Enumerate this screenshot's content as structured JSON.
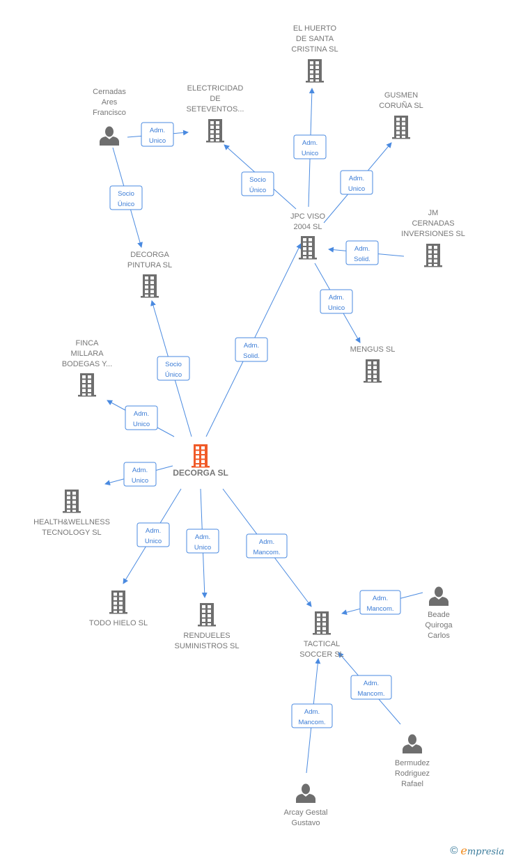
{
  "colors": {
    "main_node": "#f05a28",
    "node": "#6e6e6e",
    "edge": "#4a8ae0",
    "text": "#777777"
  },
  "nodes": [
    {
      "id": "decorga",
      "type": "company",
      "main": true,
      "label": [
        "DECORGA SL"
      ]
    },
    {
      "id": "cernadas",
      "type": "person",
      "label": [
        "Cernadas",
        "Ares",
        "Francisco"
      ]
    },
    {
      "id": "electricidad",
      "type": "company",
      "label": [
        "ELECTRICIDAD",
        "DE",
        "SETEVENTOS..."
      ]
    },
    {
      "id": "huerto",
      "type": "company",
      "label": [
        "EL HUERTO",
        "DE SANTA",
        "CRISTINA SL"
      ]
    },
    {
      "id": "gusmen",
      "type": "company",
      "label": [
        "GUSMEN",
        "CORUÑA SL"
      ]
    },
    {
      "id": "jpc",
      "type": "company",
      "label": [
        "JPC VISO",
        "2004 SL"
      ]
    },
    {
      "id": "jm",
      "type": "company",
      "label": [
        "JM",
        "CERNADAS",
        "INVERSIONES SL"
      ]
    },
    {
      "id": "mengus",
      "type": "company",
      "label": [
        "MENGUS SL"
      ]
    },
    {
      "id": "pintura",
      "type": "company",
      "label": [
        "DECORGA",
        "PINTURA SL"
      ]
    },
    {
      "id": "finca",
      "type": "company",
      "label": [
        "FINCA",
        "MILLARA",
        "BODEGAS Y..."
      ]
    },
    {
      "id": "health",
      "type": "company",
      "label": [
        "HEALTH&WELLNESS",
        "TECNOLOGY SL"
      ]
    },
    {
      "id": "todohielo",
      "type": "company",
      "label": [
        "TODO HIELO SL"
      ]
    },
    {
      "id": "rendueles",
      "type": "company",
      "label": [
        "RENDUELES",
        "SUMINISTROS SL"
      ]
    },
    {
      "id": "tactical",
      "type": "company",
      "label": [
        "TACTICAL",
        "SOCCER SL"
      ]
    },
    {
      "id": "beade",
      "type": "person",
      "label": [
        "Beade",
        "Quiroga",
        "Carlos"
      ]
    },
    {
      "id": "bermudez",
      "type": "person",
      "label": [
        "Bermudez",
        "Rodriguez",
        "Rafael"
      ]
    },
    {
      "id": "arcay",
      "type": "person",
      "label": [
        "Arcay Gestal",
        "Gustavo"
      ]
    }
  ],
  "edges": [
    {
      "from": "cernadas",
      "to": "electricidad",
      "label": [
        "Adm.",
        "Unico"
      ]
    },
    {
      "from": "cernadas",
      "to": "pintura",
      "label": [
        "Socio",
        "Único"
      ]
    },
    {
      "from": "jpc",
      "to": "electricidad",
      "label": [
        "Socio",
        "Único"
      ]
    },
    {
      "from": "jpc",
      "to": "huerto",
      "label": [
        "Adm.",
        "Unico"
      ]
    },
    {
      "from": "jpc",
      "to": "gusmen",
      "label": [
        "Adm.",
        "Unico"
      ]
    },
    {
      "from": "jm",
      "to": "jpc",
      "label": [
        "Adm.",
        "Solid."
      ]
    },
    {
      "from": "jpc",
      "to": "mengus",
      "label": [
        "Adm.",
        "Unico"
      ]
    },
    {
      "from": "decorga",
      "to": "jpc",
      "label": [
        "Adm.",
        "Solid."
      ]
    },
    {
      "from": "decorga",
      "to": "pintura",
      "label": [
        "Socio",
        "Único"
      ]
    },
    {
      "from": "decorga",
      "to": "finca",
      "label": [
        "Adm.",
        "Unico"
      ]
    },
    {
      "from": "decorga",
      "to": "health",
      "label": [
        "Adm.",
        "Unico"
      ]
    },
    {
      "from": "decorga",
      "to": "todohielo",
      "label": [
        "Adm.",
        "Unico"
      ]
    },
    {
      "from": "decorga",
      "to": "rendueles",
      "label": [
        "Adm.",
        "Unico"
      ]
    },
    {
      "from": "decorga",
      "to": "tactical",
      "label": [
        "Adm.",
        "Mancom."
      ]
    },
    {
      "from": "beade",
      "to": "tactical",
      "label": [
        "Adm.",
        "Mancom."
      ]
    },
    {
      "from": "bermudez",
      "to": "tactical",
      "label": [
        "Adm.",
        "Mancom."
      ]
    },
    {
      "from": "arcay",
      "to": "tactical",
      "label": [
        "Adm.",
        "Mancom."
      ]
    }
  ],
  "footer": {
    "copyright": "©",
    "brand_initial": "e",
    "brand_rest": "mpresia"
  }
}
